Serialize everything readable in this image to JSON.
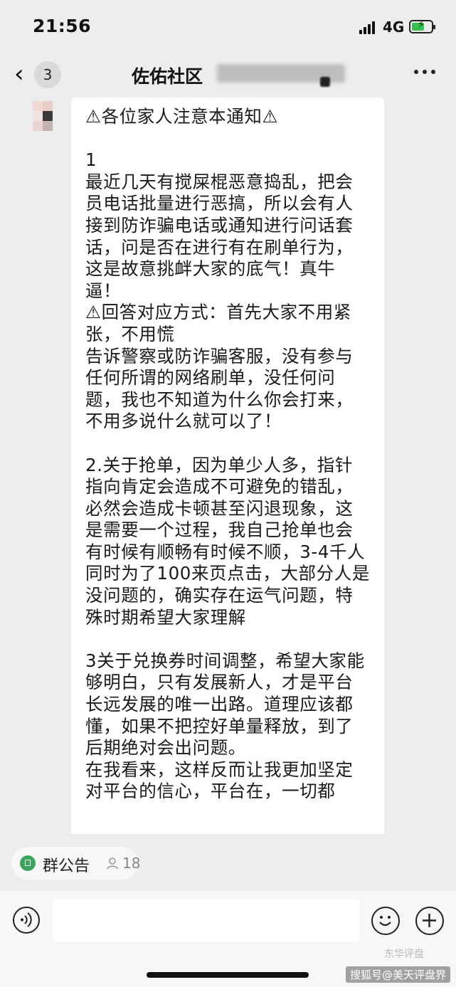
{
  "status_bar": {
    "time": "21:56",
    "network": "4G"
  },
  "nav": {
    "back_icon": "chevron-left-icon",
    "unread_count": "3",
    "title": "佐佑社区",
    "more_icon": "more-dots-icon"
  },
  "message": {
    "text": "⚠各位家人注意本通知⚠\n\n1\n最近几天有搅屎棍恶意捣乱，把会员电话批量进行恶搞，所以会有人接到防诈骗电话或通知进行问话套话，问是否在进行有在刷单行为，这是故意挑衅大家的底气！真牛逼！\n⚠回答对应方式：首先大家不用紧张，不用慌\n告诉警察或防诈骗客服，没有参与任何所谓的网络刷单，没任何问题，我也不知道为什么你会打来，不用多说什么就可以了！\n\n2.关于抢单，因为单少人多，指针指向肯定会造成不可避免的错乱，必然会造成卡顿甚至闪退现象，这是需要一个过程，我自己抢单也会有时候有顺畅有时候不顺，3-4千人同时为了100来页点击，大部分人是没问题的，确实存在运气问题，特殊时期希望大家理解\n\n3关于兑换券时间调整，希望大家能够明白，只有发展新人，才是平台长远发展的唯一出路。道理应该都懂，如果不把控好单量释放，到了后期绝对会出问题。\n在我看来，这样反而让我更加坚定对平台的信心，平台在，一切都"
  },
  "notice": {
    "label": "群公告",
    "reader_count": "18"
  },
  "watermark": {
    "text": "搜狐号@美天评盘界",
    "text2": "东华评盘"
  },
  "colors": {
    "background": "#ededed",
    "bubble": "#ffffff",
    "battery": "#33c24d",
    "notice_icon": "#3aa55c",
    "warning": "#e7b800"
  }
}
